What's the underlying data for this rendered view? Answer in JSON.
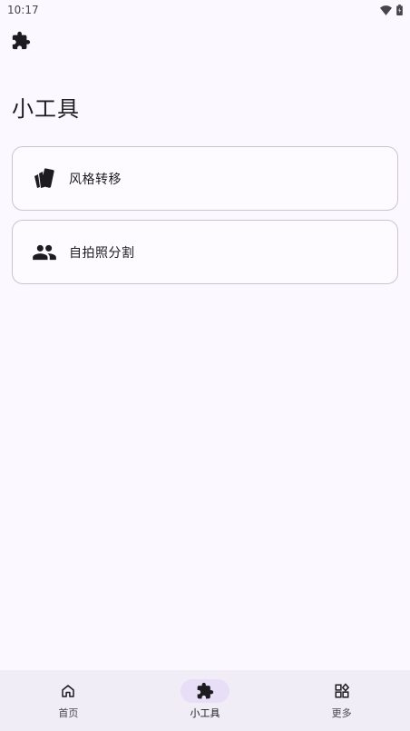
{
  "status_bar": {
    "time": "10:17"
  },
  "header": {
    "icon": "extension-icon"
  },
  "page": {
    "title": "小工具"
  },
  "tools": [
    {
      "label": "风格转移",
      "icon": "style-icon"
    },
    {
      "label": "自拍照分割",
      "icon": "people-icon"
    }
  ],
  "nav": {
    "items": [
      {
        "label": "首页",
        "icon": "home-icon",
        "active": false
      },
      {
        "label": "小工具",
        "icon": "extension-icon",
        "active": true
      },
      {
        "label": "更多",
        "icon": "widgets-icon",
        "active": false
      }
    ]
  },
  "colors": {
    "background": "#fcf8ff",
    "nav_background": "#f1edf6",
    "active_indicator": "#e8def8",
    "card_border": "#cac4d0"
  }
}
